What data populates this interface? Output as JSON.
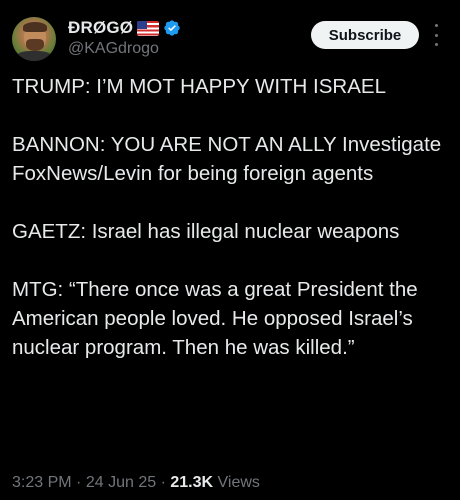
{
  "author": {
    "display_name": "ÐRØGØ",
    "handle": "@KAGdrogo",
    "flag_icon": "us-flag-icon",
    "verified_icon": "verified-badge-icon",
    "verified_color": "#1d9bf0"
  },
  "actions": {
    "subscribe_label": "Subscribe",
    "more_icon": "more-options-icon"
  },
  "post": {
    "paragraphs": [
      "TRUMP: I’M MOT HAPPY WITH ISRAEL",
      "BANNON: YOU ARE NOT AN ALLY Investigate FoxNews/Levin for being foreign agents",
      "GAETZ: Israel has illegal nuclear weapons",
      "MTG: “There once was a great President the American people loved. He opposed Israel’s nuclear program. Then he was killed.”"
    ]
  },
  "meta": {
    "time": "3:23 PM",
    "date": "24 Jun 25",
    "views_count": "21.3K",
    "views_label": "Views",
    "separator": "·"
  },
  "colors": {
    "background": "#000000",
    "text": "#e7e9ea",
    "secondary_text": "#71767b",
    "button_bg": "#eff3f4"
  }
}
